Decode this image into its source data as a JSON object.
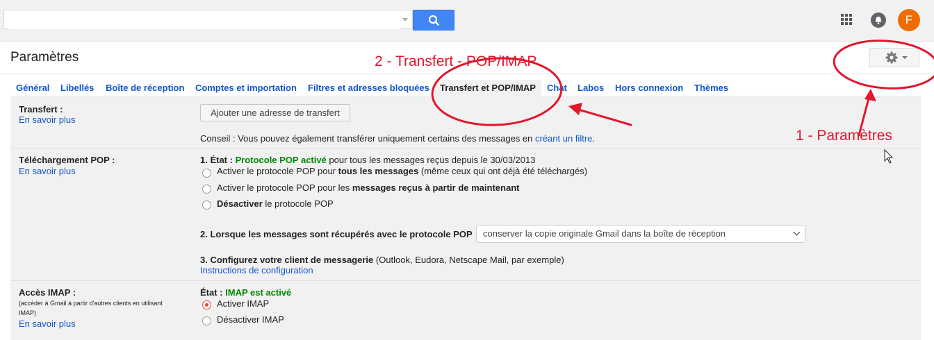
{
  "header": {
    "search_value": "",
    "avatar_letter": "F"
  },
  "page_title": "Paramètres",
  "tabs": [
    {
      "label": "Général"
    },
    {
      "label": "Libellés"
    },
    {
      "label": "Boîte de réception"
    },
    {
      "label": "Comptes et importation"
    },
    {
      "label": "Filtres et adresses bloquées"
    },
    {
      "label": "Transfert et POP/IMAP",
      "active": true
    },
    {
      "label": "Chat"
    },
    {
      "label": "Labos"
    },
    {
      "label": "Hors connexion"
    },
    {
      "label": "Thèmes"
    }
  ],
  "transfert": {
    "label": "Transfert :",
    "learn_more": "En savoir plus",
    "add_button": "Ajouter une adresse de transfert",
    "tip_prefix": "Conseil : Vous pouvez également transférer uniquement certains des messages en ",
    "tip_link": "créant un filtre",
    "tip_suffix": "."
  },
  "pop": {
    "label": "Téléchargement POP :",
    "learn_more": "En savoir plus",
    "status_prefix": "1. État : ",
    "status_value": "Protocole POP activé",
    "status_suffix": " pour tous les messages reçus depuis le 30/03/2013",
    "options": [
      {
        "before": "Activer le protocole POP pour ",
        "bold": "tous les messages",
        "after": " (même ceux qui ont déjà été téléchargés)",
        "selected": false
      },
      {
        "before": "Activer le protocole POP pour les ",
        "bold": "messages reçus à partir de maintenant",
        "after": "",
        "selected": false
      },
      {
        "before": "",
        "bold": "Désactiver",
        "after": " le protocole POP",
        "selected": false
      }
    ],
    "when_label": "2. Lorsque les messages sont récupérés avec le protocole POP",
    "when_selected": "conserver la copie originale Gmail dans la boîte de réception",
    "configure_bold": "3. Configurez votre client de messagerie",
    "configure_rest": " (Outlook, Eudora, Netscape Mail, par exemple)",
    "config_link": "Instructions de configuration"
  },
  "imap": {
    "label": "Accès IMAP :",
    "note_line1": "(accéder à Gmail à partir d'autres clients en utilisant",
    "note_line2": "IMAP)",
    "learn_more": "En savoir plus",
    "status_prefix": "État : ",
    "status_value": "IMAP est activé",
    "options": [
      {
        "label": "Activer IMAP",
        "selected": true
      },
      {
        "label": "Désactiver IMAP",
        "selected": false
      }
    ]
  },
  "annotations": {
    "step1": "1 - Paramètres",
    "step2": "2 - Transfert - POP/IMAP",
    "color": "#e2162d"
  },
  "colors": {
    "link": "#1155cc",
    "search_button": "#4285f4",
    "avatar": "#ef6c00",
    "status_green": "#008800"
  }
}
